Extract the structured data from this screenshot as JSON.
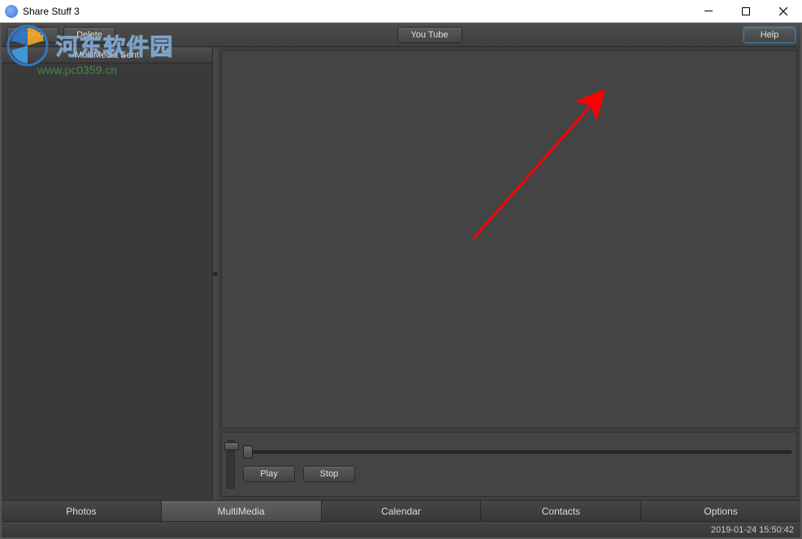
{
  "window": {
    "title": "Share Stuff 3"
  },
  "toolbar": {
    "open_label": "Open",
    "delete_label": "Delete",
    "youtube_label": "You Tube",
    "help_label": "Help"
  },
  "sidebar": {
    "header_label": "MultiMedia Sent"
  },
  "player": {
    "play_label": "Play",
    "stop_label": "Stop"
  },
  "tabs": [
    {
      "label": "Photos",
      "active": false
    },
    {
      "label": "MultiMedia",
      "active": true
    },
    {
      "label": "Calendar",
      "active": false
    },
    {
      "label": "Contacts",
      "active": false
    },
    {
      "label": "Options",
      "active": false
    }
  ],
  "status": {
    "timestamp": "2019-01-24 15:50:42"
  },
  "watermark": {
    "text_main": "河东软件园",
    "url": "www.pc0359.cn"
  }
}
